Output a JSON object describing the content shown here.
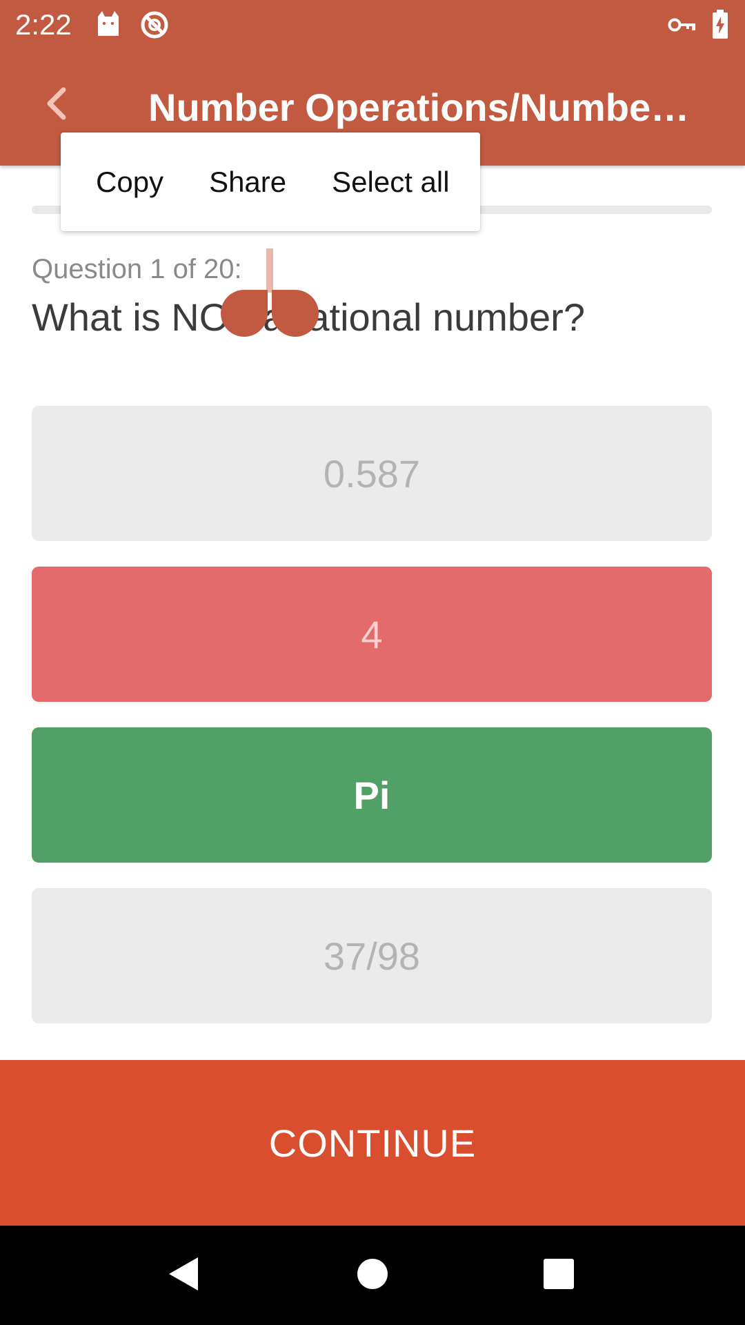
{
  "status_bar": {
    "time": "2:22",
    "icons": [
      "cat-icon",
      "do-not-disturb-icon",
      "vpn-key-icon",
      "battery-charging-icon"
    ]
  },
  "app_bar": {
    "title": "Number Operations/Number Sense",
    "back_icon": "chevron-left-icon"
  },
  "progress": {
    "value": 0.0
  },
  "context_menu": {
    "items": [
      "Copy",
      "Share",
      "Select all"
    ]
  },
  "question": {
    "counter": "Question 1 of 20:",
    "text": "What is NOT a rational number?"
  },
  "answers": [
    {
      "label": "0.587",
      "state": "neutral"
    },
    {
      "label": "4",
      "state": "wrong"
    },
    {
      "label": "Pi",
      "state": "correct"
    },
    {
      "label": "37/98",
      "state": "neutral"
    }
  ],
  "continue_button": {
    "label": "CONTINUE"
  },
  "nav_bar": {
    "icons": [
      "back-triangle-icon",
      "home-circle-icon",
      "recents-square-icon"
    ]
  },
  "colors": {
    "primary": "#c15a41",
    "accent": "#d94e2f",
    "correct": "#51a067",
    "wrong": "#e46b6b",
    "neutral": "#ebebeb"
  }
}
